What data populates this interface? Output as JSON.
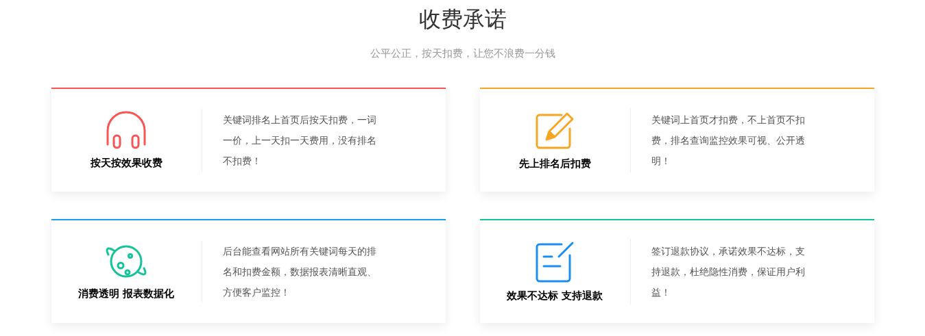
{
  "header": {
    "title": "收费承诺",
    "subtitle": "公平公正，按天扣费，让您不浪费一分钱"
  },
  "cards": [
    {
      "color": "#f75454",
      "icon": {
        "kind": "headphones",
        "color": "#f75454"
      },
      "title": "按天按效果收费",
      "description": "关键词排名上首页后按天扣费，一词一价，上一天扣一天费用，没有排名不扣费！"
    },
    {
      "color": "#f5a623",
      "icon": {
        "kind": "edit",
        "color": "#f5a623"
      },
      "title": "先上排名后扣费",
      "description": "关键词上首页才扣费，不上首页不扣费，排名查询监控效果可视、公开透明！"
    },
    {
      "color": "#1a9ff0",
      "icon": {
        "kind": "planet",
        "color": "#13c49a"
      },
      "title": "消费透明 报表数据化",
      "description": "后台能查看网站所有关键词每天的排名和扣费金额，数据报表清晰直观、方便客户监控！"
    },
    {
      "color": "#13c49a",
      "icon": {
        "kind": "note",
        "color": "#1a8ff0"
      },
      "title": "效果不达标 支持退款",
      "description": "签订退款协议，承诺效果不达标，支持退款，杜绝隐性消费，保证用户利益！"
    }
  ]
}
